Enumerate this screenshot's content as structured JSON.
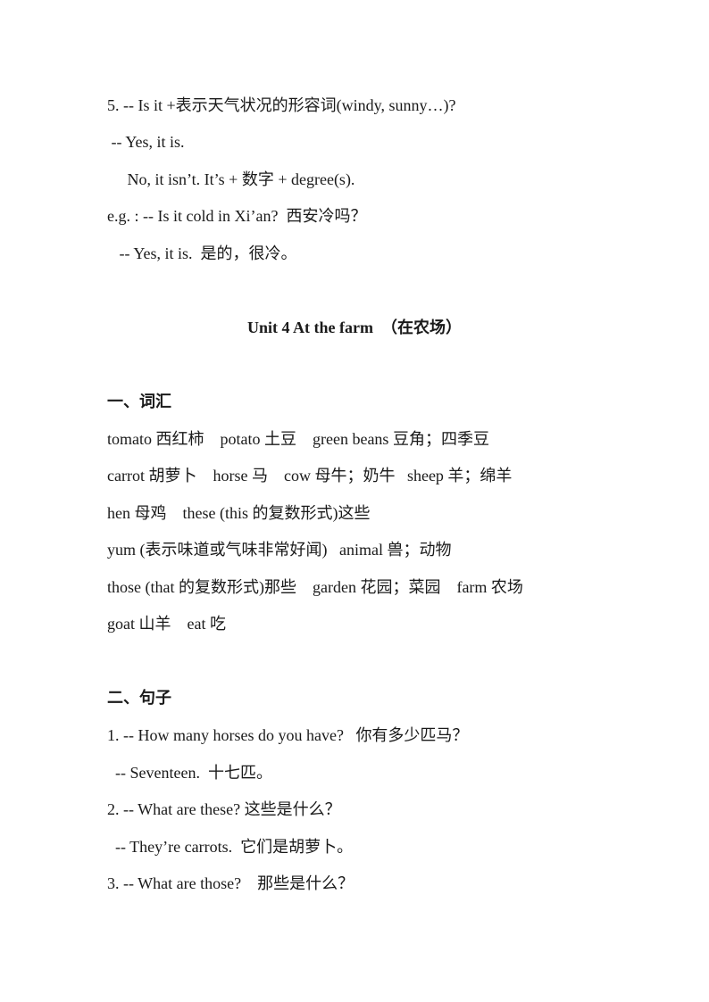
{
  "weather_section": {
    "item5_question": "5. -- Is it +表示天气状况的形容词(windy, sunny…)?",
    "item5_answer_yes": " -- Yes, it is.",
    "item5_answer_no": "     No, it isn’t. It’s + 数字 + degree(s).",
    "example_question": "e.g. : -- Is it cold in Xi’an?  西安冷吗？",
    "example_answer": "   -- Yes, it is.  是的，很冷。"
  },
  "unit": {
    "title": "Unit 4 At the farm  （在农场）"
  },
  "vocabulary": {
    "heading": "一、词汇",
    "lines": [
      "tomato 西红柿    potato 土豆    green beans 豆角；四季豆",
      "carrot 胡萝卜    horse 马    cow 母牛；奶牛   sheep 羊；绵羊",
      "hen 母鸡    these (this 的复数形式)这些",
      "yum (表示味道或气味非常好闻)   animal 兽；动物",
      "those (that 的复数形式)那些    garden 花园；菜园    farm 农场",
      "goat 山羊    eat 吃"
    ]
  },
  "sentences": {
    "heading": "二、句子",
    "lines": [
      "1. -- How many horses do you have?   你有多少匹马？",
      "  -- Seventeen.  十七匹。",
      "2. -- What are these? 这些是什么？",
      "  -- They’re carrots.  它们是胡萝卜。",
      "3. -- What are those?    那些是什么？"
    ]
  }
}
